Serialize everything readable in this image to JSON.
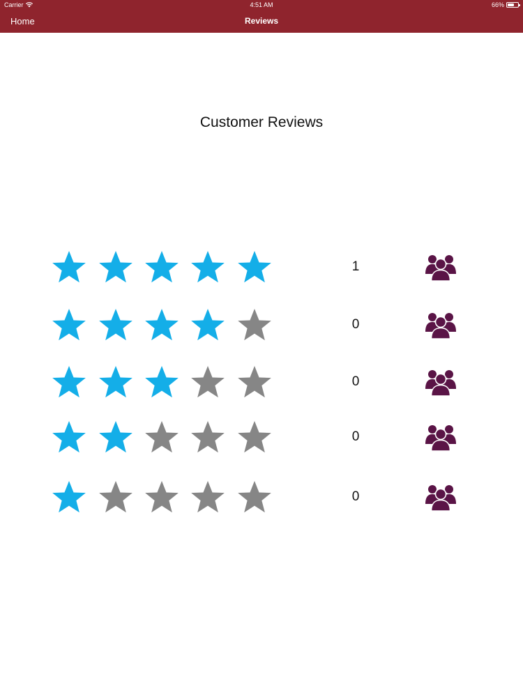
{
  "status_bar": {
    "carrier": "Carrier",
    "time": "4:51 AM",
    "battery": "66%",
    "battery_level": 0.66
  },
  "nav": {
    "back_label": "Home",
    "title": "Reviews"
  },
  "heading": "Customer Reviews",
  "colors": {
    "nav_background": "#8f242d",
    "star_filled": "#14aee8",
    "star_empty": "#868686",
    "people_icon": "#5a1446"
  },
  "rating_rows": [
    {
      "stars": 5,
      "filled": 5,
      "count": "1",
      "icon": "people-group-icon"
    },
    {
      "stars": 4,
      "filled": 4,
      "count": "0",
      "icon": "people-group-icon"
    },
    {
      "stars": 3,
      "filled": 3,
      "count": "0",
      "icon": "people-group-icon"
    },
    {
      "stars": 2,
      "filled": 2,
      "count": "0",
      "icon": "people-group-icon"
    },
    {
      "stars": 1,
      "filled": 1,
      "count": "0",
      "icon": "people-group-icon"
    }
  ]
}
